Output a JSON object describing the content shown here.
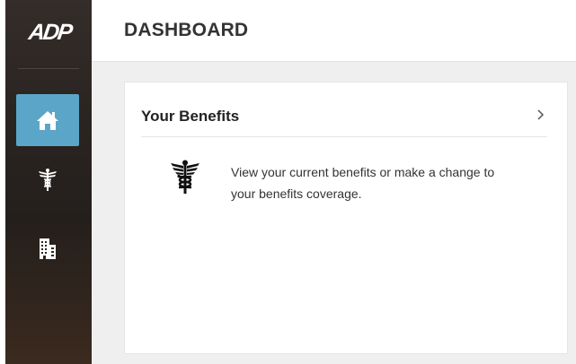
{
  "brand": {
    "logo_text": "ADP"
  },
  "sidebar": {
    "items": [
      {
        "name": "home",
        "icon": "home-icon",
        "active": true
      },
      {
        "name": "benefits",
        "icon": "caduceus-icon",
        "active": false
      },
      {
        "name": "company",
        "icon": "building-icon",
        "active": false
      }
    ]
  },
  "header": {
    "title": "DASHBOARD"
  },
  "card": {
    "title": "Your Benefits",
    "description": "View your current benefits or make a change to your benefits coverage.",
    "icon": "caduceus-icon",
    "chevron": "chevron-right-icon"
  },
  "colors": {
    "sidebar_bg": "#2b2522",
    "active_item": "#5ba5c8",
    "main_bg": "#efefef",
    "card_bg": "#ffffff",
    "text": "#333333"
  }
}
